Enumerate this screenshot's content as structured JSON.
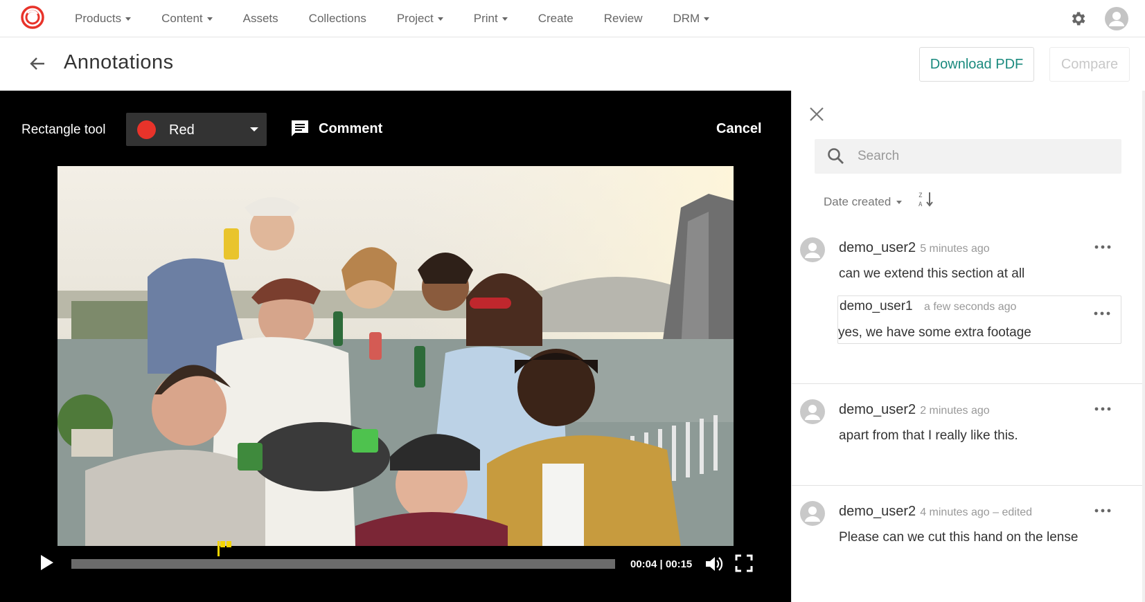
{
  "nav": {
    "items": [
      {
        "label": "Products",
        "dropdown": true
      },
      {
        "label": "Content",
        "dropdown": true
      },
      {
        "label": "Assets",
        "dropdown": false
      },
      {
        "label": "Collections",
        "dropdown": false
      },
      {
        "label": "Project",
        "dropdown": true
      },
      {
        "label": "Print",
        "dropdown": true
      },
      {
        "label": "Create",
        "dropdown": false
      },
      {
        "label": "Review",
        "dropdown": false
      },
      {
        "label": "DRM",
        "dropdown": true
      }
    ]
  },
  "header": {
    "title": "Annotations",
    "download_label": "Download PDF",
    "compare_label": "Compare"
  },
  "toolbar": {
    "tool_label": "Rectangle tool",
    "color_value": "Red",
    "color_hex": "#e8332a",
    "comment_label": "Comment",
    "cancel_label": "Cancel"
  },
  "player": {
    "time_current": "00:04",
    "time_total": "00:15",
    "time_display": "00:04 | 00:15",
    "progress_fraction": 0.27
  },
  "panel": {
    "search_placeholder": "Search",
    "sort_label": "Date created",
    "comments": [
      {
        "author": "demo_user2",
        "time": "5 minutes ago",
        "text": "can we extend this section at all",
        "reply": {
          "author": "demo_user1",
          "time": "a few seconds ago",
          "text": "yes, we have some extra footage"
        }
      },
      {
        "author": "demo_user2",
        "time": "2 minutes ago",
        "text": "apart from that I really like this."
      },
      {
        "author": "demo_user2",
        "time": "4 minutes ago – edited",
        "text": "Please can we cut this hand on the lense"
      }
    ]
  },
  "colors": {
    "accent_teal": "#1a8a7e",
    "brand_red": "#e8332a",
    "marker_yellow": "#f3d400"
  }
}
